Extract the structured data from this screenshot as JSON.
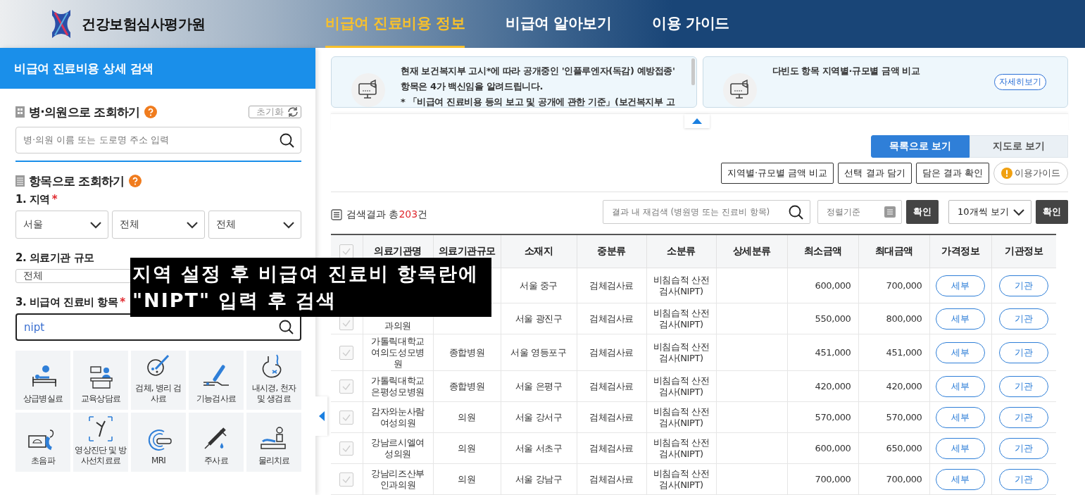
{
  "header": {
    "logo_text": "건강보험심사평가원",
    "nav": [
      {
        "label": "비급여 진료비용 정보",
        "selected": true
      },
      {
        "label": "비급여 알아보기",
        "selected": false
      },
      {
        "label": "이용 가이드",
        "selected": false
      }
    ]
  },
  "sidebar": {
    "title": "비급여 진료비용 상세 검색",
    "hospital_search": {
      "heading": "병·의원으로 조회하기",
      "reset_label": "초기화",
      "placeholder": "병·의원 이름 또는 도로명 주소 입력"
    },
    "item_search": {
      "heading": "항목으로 조회하기",
      "region_label": "1. 지역",
      "region_required": "*",
      "region_selects": [
        "서울",
        "전체",
        "전체"
      ],
      "scale_label": "2. 의료기관 규모",
      "scale_select": "전체",
      "item_label": "3. 비급여 진료비 항목",
      "item_required": "*",
      "item_value": "nipt",
      "categories": [
        {
          "label": "상급병실료",
          "kind": "bed"
        },
        {
          "label": "교육상담료",
          "kind": "counsel"
        },
        {
          "label": "검체, 병리 검사료",
          "kind": "specimen"
        },
        {
          "label": "기능검사료",
          "kind": "function"
        },
        {
          "label": "내시경, 천자 및 생검료",
          "kind": "endoscope"
        },
        {
          "label": "초음파",
          "kind": "ultrasound"
        },
        {
          "label": "영상진단 및 방사선치료료",
          "kind": "xray"
        },
        {
          "label": "MRI",
          "kind": "mri"
        },
        {
          "label": "주사료",
          "kind": "injection"
        },
        {
          "label": "물리치료",
          "kind": "therapy"
        }
      ]
    }
  },
  "notices": [
    {
      "lines": [
        "현재 보건복지부 고시*에 따라 공개중인 '인플루엔자(독감) 예방접종'",
        "항목은 4가 백신임을 알려드립니다.",
        "* 「비급여 진료비용 등의 보고 및 공개에 관한 기준」(보건복지부 고"
      ]
    },
    {
      "lines": [
        "다빈도 항목 지역별·규모별 금액 비교"
      ],
      "button": "자세히보기"
    }
  ],
  "view_toggle": [
    {
      "label": "목록으로 보기",
      "selected": true
    },
    {
      "label": "지도로 보기",
      "selected": false
    }
  ],
  "actions": [
    "지역별·규모별 금액 비교",
    "선택 결과 담기",
    "담은 결과 확인"
  ],
  "guide_button": "이용가이드",
  "results": {
    "prefix": "검색결과 총",
    "count": "203",
    "suffix": "건"
  },
  "filter": {
    "research_placeholder": "결과 내 재검색 (병원명 또는 진료비 항목)",
    "sort_placeholder": "정렬기준",
    "confirm": "확인",
    "page_size": "10개씩 보기",
    "page_confirm": "확인"
  },
  "table": {
    "all_checked": false,
    "columns": [
      "의료기관명",
      "의료기관규모",
      "소재지",
      "중분류",
      "소분류",
      "상세분류",
      "최소금액",
      "최대금액",
      "가격정보",
      "기관정보"
    ],
    "rows": [
      {
        "location": "서울 중구",
        "mid": "검체검사료",
        "small": "비침습적 산전 검사(NIPT)",
        "min": "600,000",
        "max": "700,000",
        "price": "세부",
        "inst": "기관"
      },
      {
        "checked": false,
        "name": "과의원",
        "location": "서울 광진구",
        "mid": "검체검사료",
        "small": "비침습적 산전 검사(NIPT)",
        "min": "550,000",
        "max": "800,000",
        "price": "세부",
        "inst": "기관"
      },
      {
        "checked": false,
        "name": "가톨릭대학교 여의도성모병원",
        "scale": "종합병원",
        "location": "서울 영등포구",
        "mid": "검체검사료",
        "small": "비침습적 산전 검사(NIPT)",
        "min": "451,000",
        "max": "451,000",
        "price": "세부",
        "inst": "기관"
      },
      {
        "checked": false,
        "name": "가톨릭대학교 은평성모병원",
        "scale": "종합병원",
        "location": "서울 은평구",
        "mid": "검체검사료",
        "small": "비침습적 산전 검사(NIPT)",
        "min": "420,000",
        "max": "420,000",
        "price": "세부",
        "inst": "기관"
      },
      {
        "checked": false,
        "name": "감자와눈사람 여성의원",
        "scale": "의원",
        "location": "서울 강서구",
        "mid": "검체검사료",
        "small": "비침습적 산전 검사(NIPT)",
        "min": "570,000",
        "max": "570,000",
        "price": "세부",
        "inst": "기관"
      },
      {
        "checked": false,
        "name": "강남르시엘여 성의원",
        "scale": "의원",
        "location": "서울 서초구",
        "mid": "검체검사료",
        "small": "비침습적 산전 검사(NIPT)",
        "min": "600,000",
        "max": "650,000",
        "price": "세부",
        "inst": "기관"
      },
      {
        "checked": false,
        "name": "강남리즈산부 인과의원",
        "scale": "의원",
        "location": "서울 강남구",
        "mid": "검체검사료",
        "small": "비침습적 산전 검사(NIPT)",
        "min": "700,000",
        "max": "700,000",
        "price": "세부",
        "inst": "기관"
      }
    ]
  },
  "caption": {
    "lines": [
      "지역 설정 후 비급여 진료비 항목란에",
      "\"NIPT\" 입력 후 검색"
    ]
  }
}
